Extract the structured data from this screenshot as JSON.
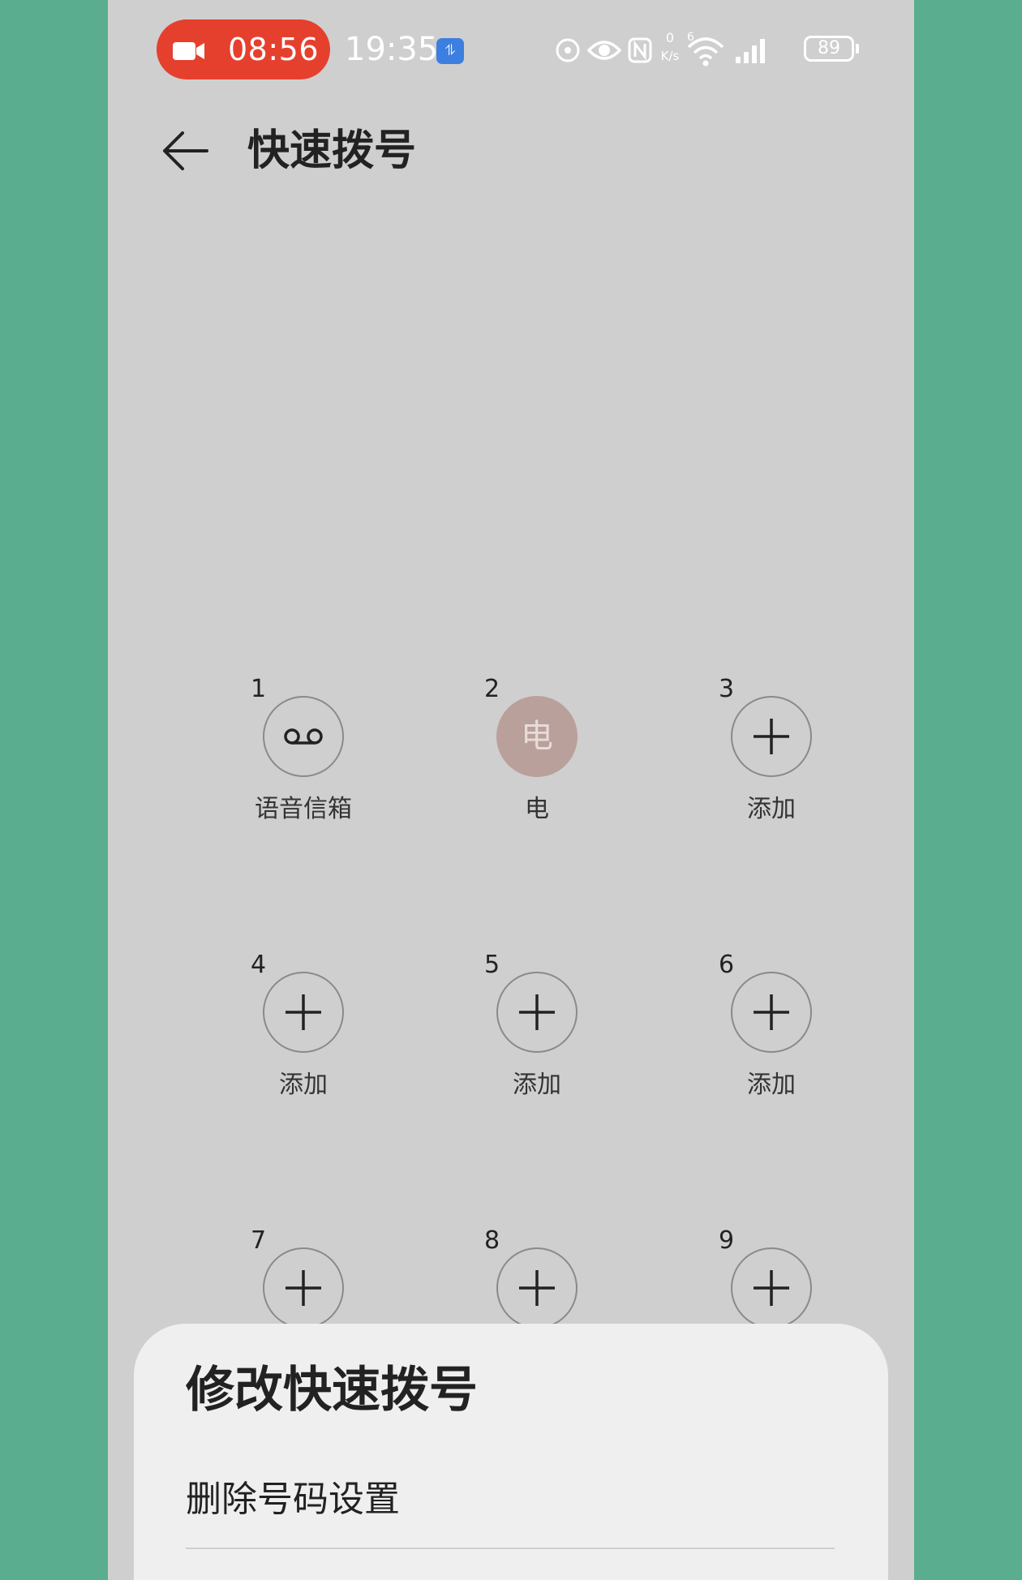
{
  "status_bar": {
    "recording_time": "08:56",
    "clock": "19:35",
    "notification_badge": "⥮",
    "net_speed_top": "0",
    "net_speed_unit": "K/s",
    "wifi_generation": "6",
    "battery_level": "89",
    "recording_color": "#e5402d",
    "badge_color": "#3d7fe0"
  },
  "header": {
    "title": "快速拨号"
  },
  "speed_dial": [
    {
      "number": "1",
      "label": "语音信箱",
      "type": "voicemail",
      "icon": "voicemail-icon"
    },
    {
      "number": "2",
      "label": "电",
      "type": "contact",
      "avatar": "电",
      "avatar_color": "#b9a09b"
    },
    {
      "number": "3",
      "label": "添加",
      "type": "add",
      "icon": "plus-icon"
    },
    {
      "number": "4",
      "label": "添加",
      "type": "add",
      "icon": "plus-icon"
    },
    {
      "number": "5",
      "label": "添加",
      "type": "add",
      "icon": "plus-icon"
    },
    {
      "number": "6",
      "label": "添加",
      "type": "add",
      "icon": "plus-icon"
    },
    {
      "number": "7",
      "label": "",
      "type": "add",
      "icon": "plus-icon"
    },
    {
      "number": "8",
      "label": "",
      "type": "add",
      "icon": "plus-icon"
    },
    {
      "number": "9",
      "label": "",
      "type": "add",
      "icon": "plus-icon"
    }
  ],
  "sheet": {
    "title": "修改快速拨号",
    "options": [
      "删除号码设置"
    ]
  }
}
